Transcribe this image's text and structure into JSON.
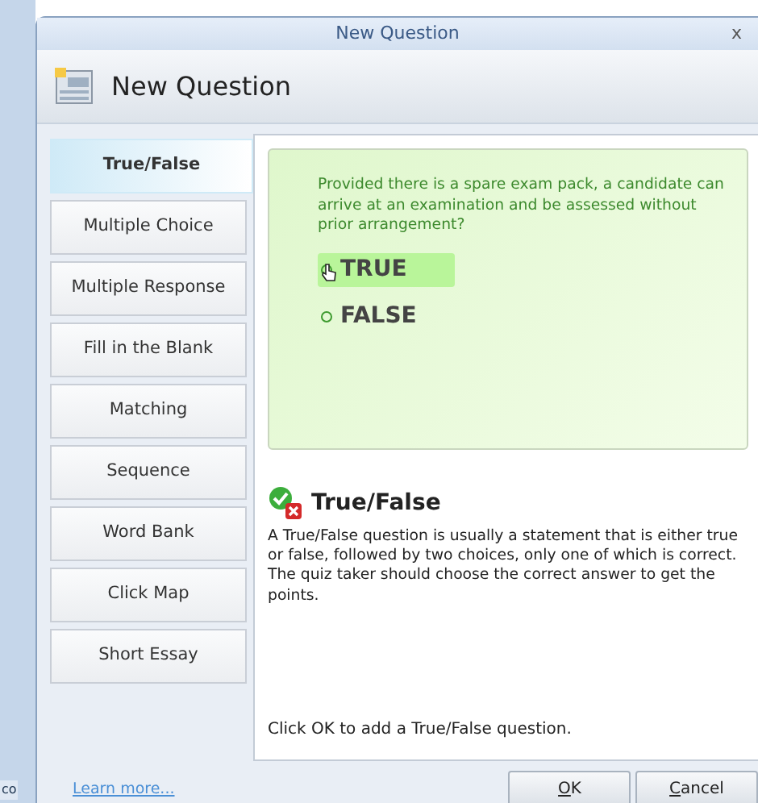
{
  "background_window": {
    "text": "co"
  },
  "window": {
    "title": "New Question",
    "close": "x"
  },
  "header": {
    "title": "New Question"
  },
  "question_types": [
    {
      "label": "True/False",
      "selected": true
    },
    {
      "label": "Multiple Choice",
      "selected": false
    },
    {
      "label": "Multiple Response",
      "selected": false
    },
    {
      "label": "Fill in the Blank",
      "selected": false
    },
    {
      "label": "Matching",
      "selected": false
    },
    {
      "label": "Sequence",
      "selected": false
    },
    {
      "label": "Word Bank",
      "selected": false
    },
    {
      "label": "Click Map",
      "selected": false
    },
    {
      "label": "Short Essay",
      "selected": false
    }
  ],
  "preview": {
    "question": "Provided there is a spare exam pack, a candidate can arrive at an examination and be assessed without prior arrangement?",
    "options": [
      {
        "label": "TRUE",
        "selected": true
      },
      {
        "label": "FALSE",
        "selected": false
      }
    ]
  },
  "description": {
    "title": "True/False",
    "text": "A True/False question is usually a statement that is either true or false, followed by two choices, only one of which is correct. The quiz taker should choose the correct answer to get the points.",
    "hint": "Click OK to add a True/False question."
  },
  "footer": {
    "link": "Learn more...",
    "buttons": [
      {
        "label_parts": [
          {
            "text": "O",
            "underlined": true
          },
          {
            "text": "K",
            "underlined": false
          }
        ]
      },
      {
        "label_parts": [
          {
            "text": "C",
            "underlined": true
          },
          {
            "text": "ancel",
            "underlined": false
          }
        ]
      }
    ]
  }
}
